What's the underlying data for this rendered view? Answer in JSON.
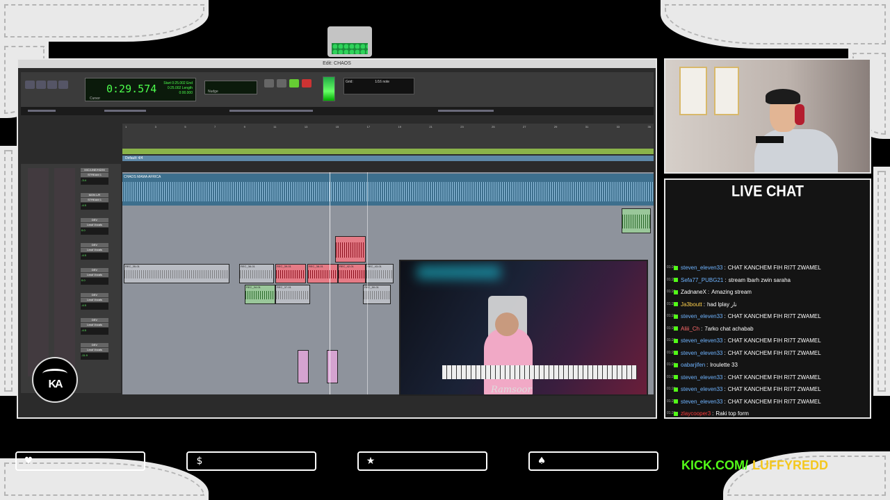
{
  "daw": {
    "window_title": "Edit: CHAOS",
    "counter_main": "0:29.574",
    "counter_label": "Cursor",
    "counter_side": "Start 0:25.002 End 0:25.002 Length 0:00.000",
    "nudge_label": "Nudge",
    "grid_label": "Grid:",
    "grid_value": "1/16 note",
    "meter_label": "Default: 4/4",
    "track_main_label": "CHAOS MAMA AFRICA",
    "clips": [
      "REC_35-01",
      "REC_36-01",
      "REC_39-01",
      "REC_38-01",
      "REC_42-01",
      "REC_43-01",
      "REC_34-01",
      "REC_37-01",
      "REC_50-01"
    ],
    "mixer_strips": [
      {
        "name": "MIC/LINE/HIZ/M",
        "io": "STREAM 1",
        "vol": "-3.4"
      },
      {
        "name": "MON L/R",
        "io": "STREAM 1",
        "vol": "-4.5"
      },
      {
        "name": "DEV",
        "io": "Lead Vocals",
        "vol": "0.0"
      },
      {
        "name": "DEV",
        "io": "Lead Vocals",
        "vol": "-4.5"
      },
      {
        "name": "DEV",
        "io": "Lead Vocals",
        "vol": "0.0"
      },
      {
        "name": "DEV",
        "io": "Lead Vocals",
        "vol": "-4.5"
      },
      {
        "name": "DEV",
        "io": "Lead Vocals",
        "vol": "-4.5"
      },
      {
        "name": "DEV",
        "io": "Lead Vocals",
        "vol": "-11.9"
      }
    ],
    "ruler_ticks": [
      "1",
      "3",
      "5",
      "7",
      "9",
      "11",
      "13",
      "15",
      "17",
      "19",
      "21",
      "23",
      "25",
      "27",
      "29",
      "31",
      "33",
      "35"
    ],
    "pip_signature": "Ramsoor"
  },
  "logo": {
    "text": "KA"
  },
  "chat": {
    "title": "LIVE CHAT",
    "messages": [
      {
        "time": "01:24",
        "user": "steven_eleven33",
        "color": "#6fb4ff",
        "text": "CHAT KANCHEM FIH RI7T ZWAMEL"
      },
      {
        "time": "01:24",
        "user": "Sefa77_PUBG21",
        "color": "#6fb4ff",
        "text": "stream lbarh zwin saraha"
      },
      {
        "time": "01:24",
        "user": "ZadnaneX",
        "color": "#ffffff",
        "text": "Amazing stream"
      },
      {
        "time": "01:24",
        "user": "Ja3boutt",
        "color": "#ffd24d",
        "text": "had lplay نار"
      },
      {
        "time": "01:24",
        "user": "steven_eleven33",
        "color": "#6fb4ff",
        "text": "CHAT KANCHEM FIH RI7T ZWAMEL"
      },
      {
        "time": "01:24",
        "user": "Aliii_Ch",
        "color": "#ff6b6b",
        "text": "7arko chat achabab"
      },
      {
        "time": "01:24",
        "user": "steven_eleven33",
        "color": "#6fb4ff",
        "text": "CHAT KANCHEM FIH RI7T ZWAMEL"
      },
      {
        "time": "01:24",
        "user": "steven_eleven33",
        "color": "#6fb4ff",
        "text": "CHAT KANCHEM FIH RI7T ZWAMEL"
      },
      {
        "time": "01:24",
        "user": "oabarjifen",
        "color": "#6fb4ff",
        "text": "lroulette 33"
      },
      {
        "time": "01:24",
        "user": "steven_eleven33",
        "color": "#6fb4ff",
        "text": "CHAT KANCHEM FIH RI7T ZWAMEL"
      },
      {
        "time": "01:24",
        "user": "steven_eleven33",
        "color": "#6fb4ff",
        "text": "CHAT KANCHEM FIH RI7T ZWAMEL"
      },
      {
        "time": "01:24",
        "user": "steven_eleven33",
        "color": "#6fb4ff",
        "text": "CHAT KANCHEM FIH RI7T ZWAMEL"
      },
      {
        "time": "01:24",
        "user": "zlaycooper3",
        "color": "#ff3b3b",
        "text": "Raki top form"
      }
    ]
  },
  "social_buttons": [
    {
      "icon": "heart-icon",
      "glyph": "♥"
    },
    {
      "icon": "dollar-icon",
      "glyph": "$"
    },
    {
      "icon": "star-icon",
      "glyph": "★"
    },
    {
      "icon": "drop-icon",
      "glyph": "♠"
    }
  ],
  "kick": {
    "domain": "KICK.COM/",
    "handle": "LUFFYREDD"
  },
  "colors": {
    "kick_green": "#53fc18",
    "accent_yellow": "#f4c81f"
  }
}
